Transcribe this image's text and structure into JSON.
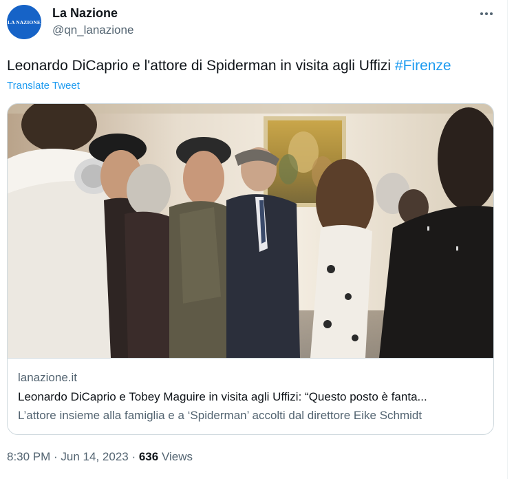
{
  "tweet": {
    "avatar_text": "LA NAZIONE",
    "display_name": "La Nazione",
    "handle": "@qn_lanazione",
    "more_icon": "more-horizontal-icon",
    "text_main": "Leonardo DiCaprio e l'attore di Spiderman in visita agli Uffizi ",
    "hashtag": "#Firenze",
    "translate_label": "Translate Tweet",
    "card": {
      "domain": "lanazione.it",
      "title": "Leonardo DiCaprio e Tobey Maguire in visita agli Uffizi: “Questo posto è fanta...",
      "description": "L’attore insieme alla famiglia e a ‘Spiderman’ accolti dal direttore Eike Schmidt"
    },
    "timestamp": "8:30 PM · Jun 14, 2023",
    "separator": " · ",
    "views_count": "636",
    "views_label": " Views"
  },
  "colors": {
    "accent": "#1d9bf0",
    "text_primary": "#0f1419",
    "text_secondary": "#536471",
    "border": "#cfd9de",
    "avatar_bg": "#1663c7"
  }
}
